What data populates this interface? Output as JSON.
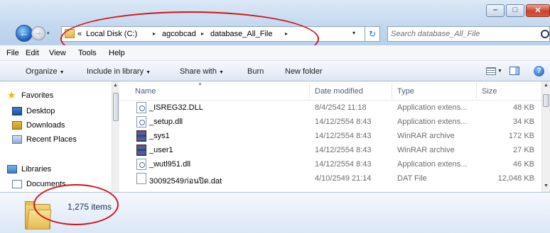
{
  "window": {
    "controls": {
      "minimize": "–",
      "maximize": "□",
      "close": "✕"
    }
  },
  "navigation": {
    "back_icon": "back-arrow-icon",
    "forward_icon": "forward-arrow-icon",
    "recent_icon": "▾"
  },
  "address": {
    "overflow": "«",
    "crumbs": [
      "Local Disk (C:)",
      "agcobcad",
      "database_All_File"
    ],
    "separator": "▸",
    "dropdown": "▾",
    "refresh": "↻"
  },
  "search": {
    "placeholder": "Search database_All_File"
  },
  "menu": [
    "File",
    "Edit",
    "View",
    "Tools",
    "Help"
  ],
  "toolbar": {
    "organize": "Organize",
    "include_in_library": "Include in library",
    "share_with": "Share with",
    "burn": "Burn",
    "new_folder": "New folder",
    "help": "?"
  },
  "nav_pane": {
    "favorites": "Favorites",
    "desktop": "Desktop",
    "downloads": "Downloads",
    "recent_places": "Recent Places",
    "libraries": "Libraries",
    "documents": "Documents"
  },
  "columns": {
    "name": "Name",
    "date": "Date modified",
    "type": "Type",
    "size": "Size"
  },
  "files": [
    {
      "name": "_ISREG32.DLL",
      "date": "8/4/2542 11:18",
      "type": "Application extens...",
      "size": "48 KB",
      "icon": "dll-icon"
    },
    {
      "name": "_setup.dll",
      "date": "14/12/2554 8:43",
      "type": "Application extens...",
      "size": "34 KB",
      "icon": "dll-icon"
    },
    {
      "name": "_sys1",
      "date": "14/12/2554 8:43",
      "type": "WinRAR archive",
      "size": "172 KB",
      "icon": "rar-icon"
    },
    {
      "name": "_user1",
      "date": "14/12/2554 8:43",
      "type": "WinRAR archive",
      "size": "27 KB",
      "icon": "rar-icon"
    },
    {
      "name": "_wutl951.dll",
      "date": "14/12/2554 8:43",
      "type": "Application extens...",
      "size": "46 KB",
      "icon": "dll-icon"
    },
    {
      "name": "30092549ก่อนปิด.dat",
      "date": "4/10/2549 21:14",
      "type": "DAT File",
      "size": "12,048 KB",
      "icon": "dat-icon"
    }
  ],
  "details": {
    "item_count": "1,275 items"
  },
  "colors": {
    "annotation": "#d0161a",
    "titlebar": "#c4d8ee"
  }
}
